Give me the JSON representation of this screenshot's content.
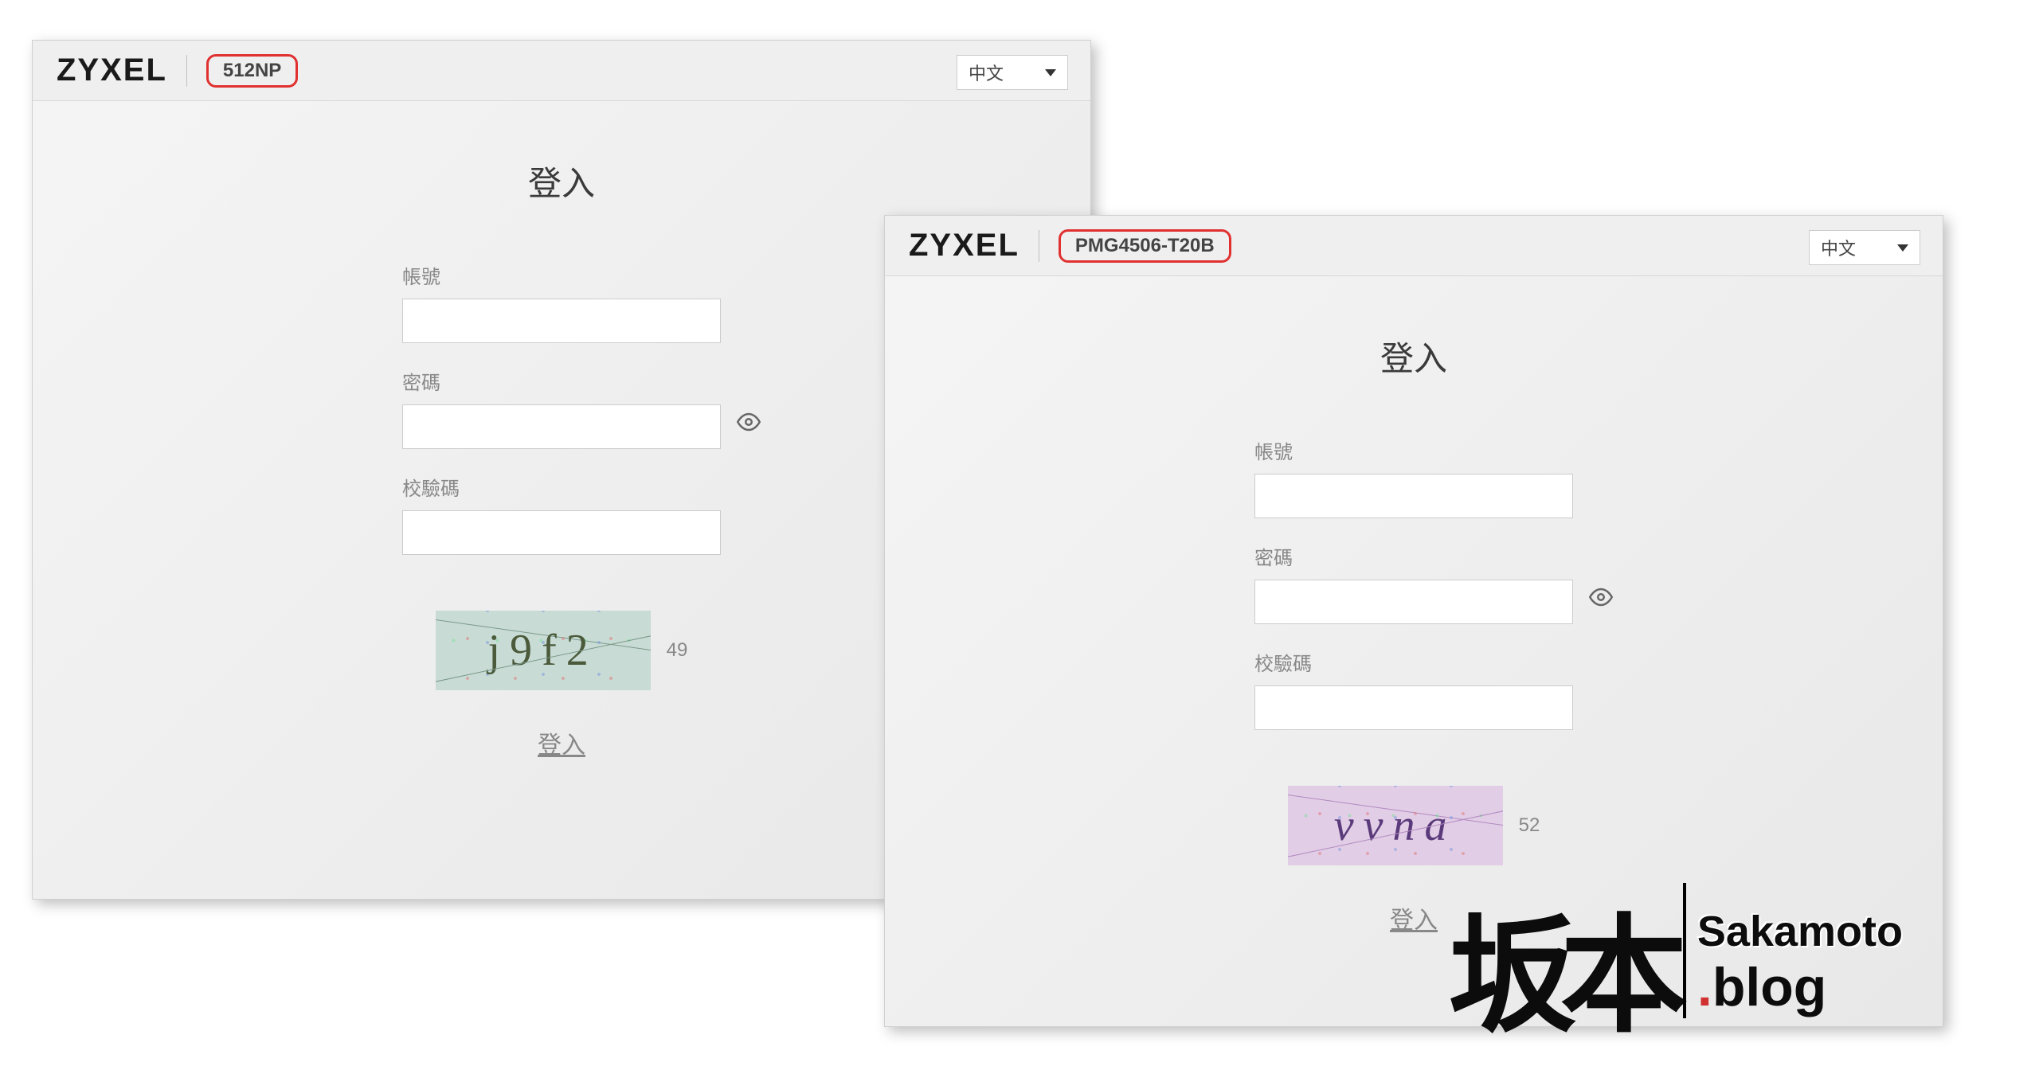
{
  "brand": "ZYXEL",
  "windows": [
    {
      "model": "512NP",
      "language_selected": "中文",
      "login_title": "登入",
      "labels": {
        "account": "帳號",
        "password": "密碼",
        "captcha": "校驗碼"
      },
      "captcha_text": "j9f2",
      "captcha_timer": "49",
      "login_button": "登入"
    },
    {
      "model": "PMG4506-T20B",
      "language_selected": "中文",
      "login_title": "登入",
      "labels": {
        "account": "帳號",
        "password": "密碼",
        "captcha": "校驗碼"
      },
      "captcha_text": "vvna",
      "captcha_timer": "52",
      "login_button": "登入"
    }
  ],
  "watermark": {
    "brush": "坂本",
    "line1": "Sakamoto",
    "line2_prefix": ".",
    "line2_text": "blog"
  }
}
